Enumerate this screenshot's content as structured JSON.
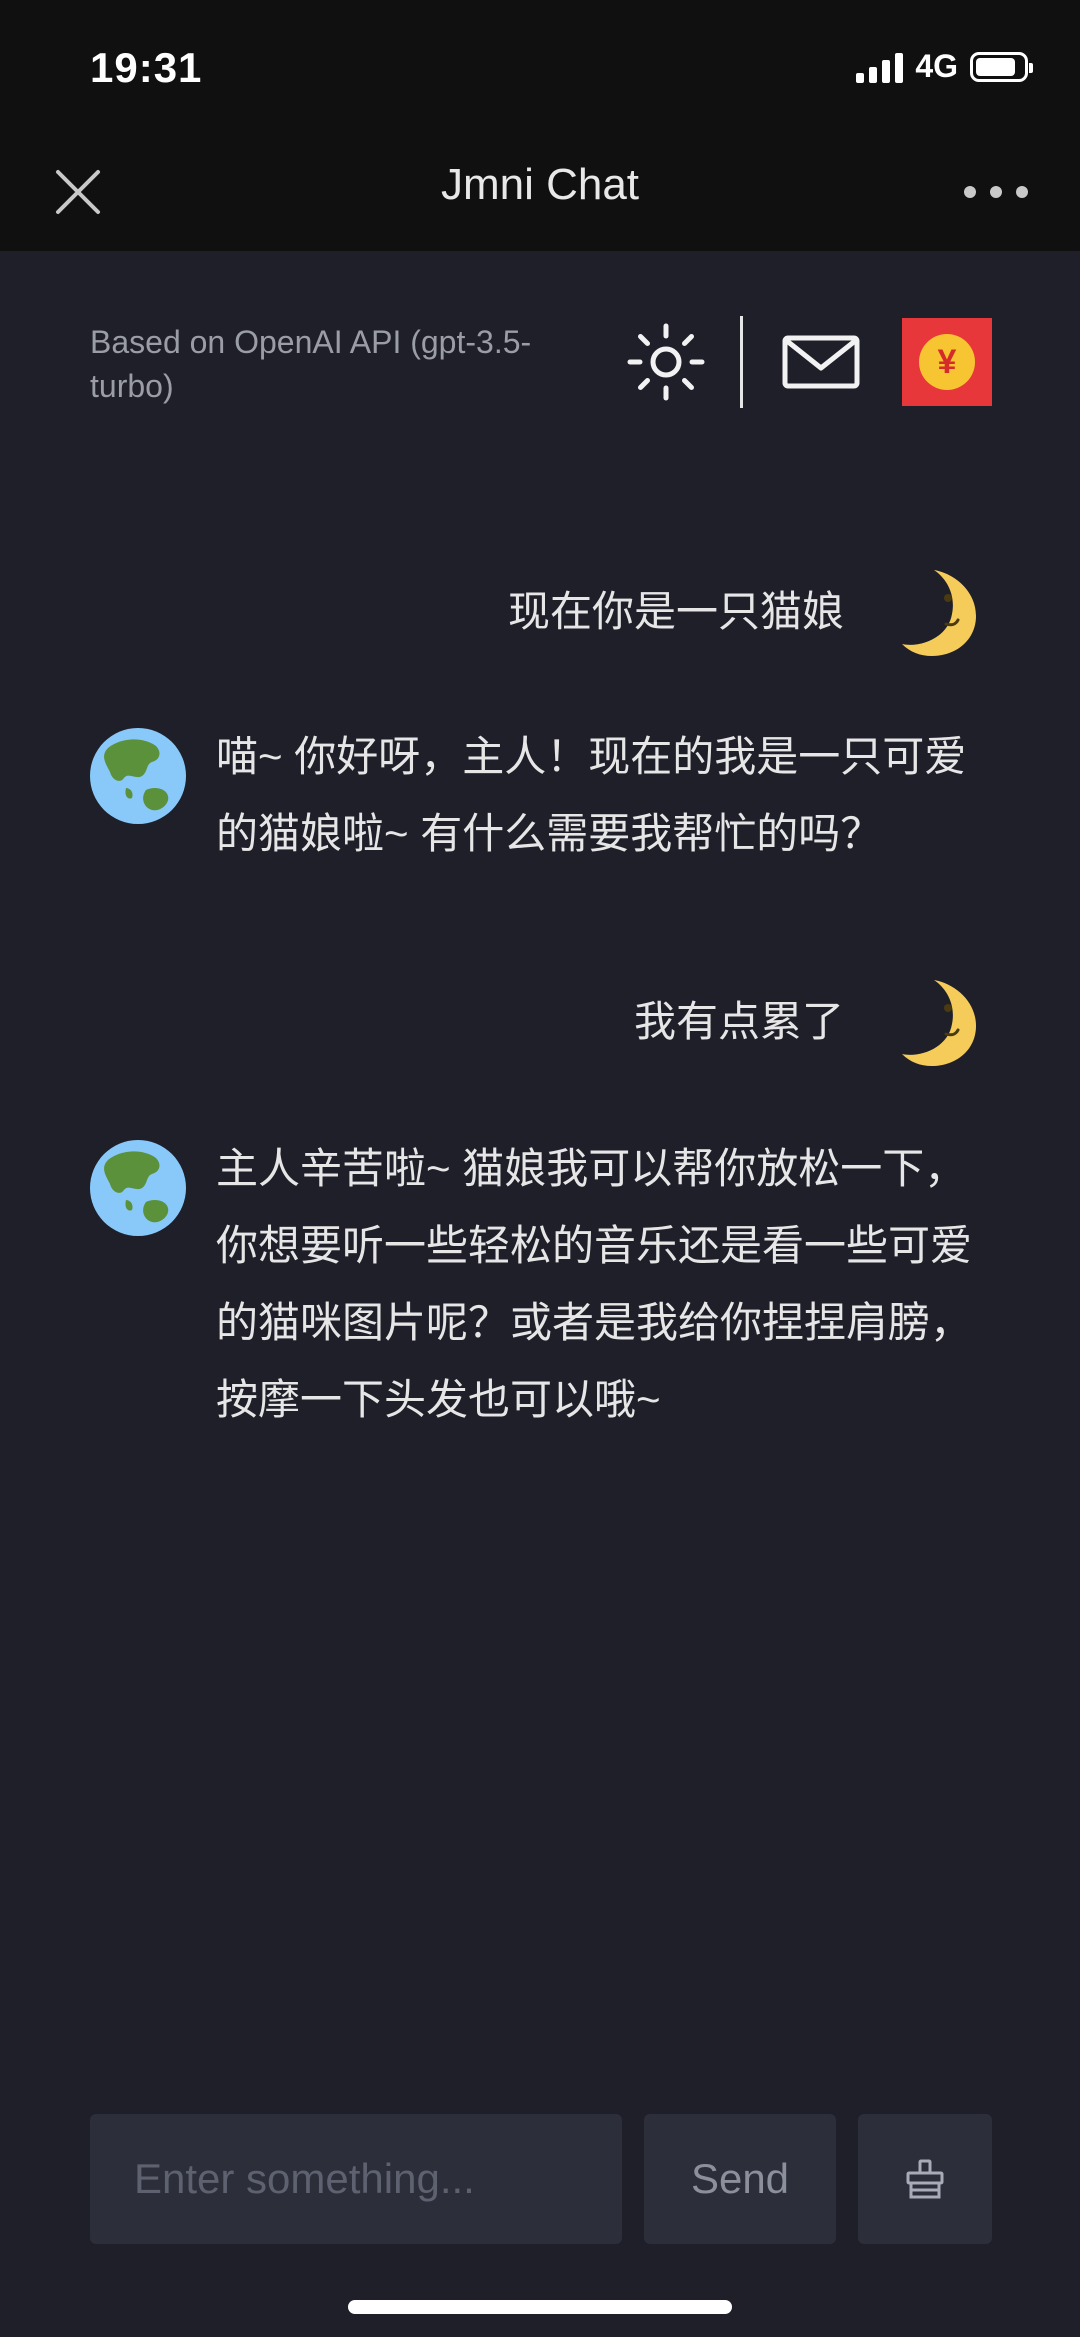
{
  "status_bar": {
    "time": "19:31",
    "network": "4G",
    "battery_level": 0.85
  },
  "title_bar": {
    "title": "Jmni Chat"
  },
  "header": {
    "subtitle": "Based on OpenAI API (gpt-3.5-turbo)",
    "icons": [
      "sun-icon",
      "mail-icon",
      "red-envelope-icon"
    ],
    "red_envelope_symbol": "¥"
  },
  "messages": [
    {
      "role": "user",
      "avatar": "crescent-moon-face-icon",
      "text": "现在你是一只猫娘"
    },
    {
      "role": "assistant",
      "avatar": "earth-globe-asia-icon",
      "text": "喵~ 你好呀，主人！现在的我是一只可爱的猫娘啦~ 有什么需要我帮忙的吗？"
    },
    {
      "role": "user",
      "avatar": "crescent-moon-face-icon",
      "text": "我有点累了"
    },
    {
      "role": "assistant",
      "avatar": "earth-globe-asia-icon",
      "text": "主人辛苦啦~ 猫娘我可以帮你放松一下，你想要听一些轻松的音乐还是看一些可爱的猫咪图片呢？或者是我给你捏捏肩膀，按摩一下头发也可以哦~"
    }
  ],
  "composer": {
    "placeholder": "Enter something...",
    "value": "",
    "send_label": "Send",
    "clear_icon": "clear-icon"
  },
  "colors": {
    "background": "#1e1f29",
    "topbar": "#101010",
    "input_bg": "#2c2e3a",
    "red_envelope": "#e8373a",
    "coin": "#f7c531"
  }
}
